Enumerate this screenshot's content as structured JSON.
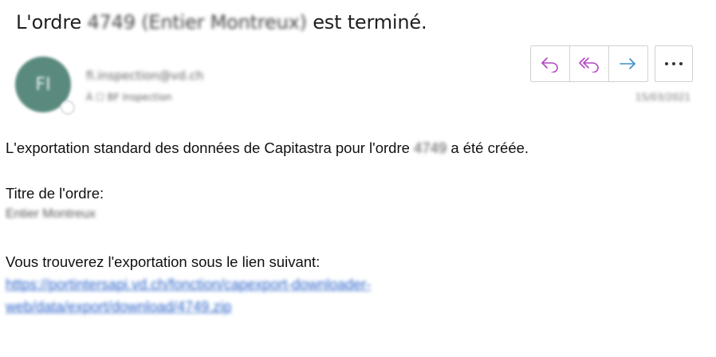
{
  "subject": {
    "prefix": "L'ordre",
    "redacted": "4749 (Entier Montreux)",
    "suffix": "est terminé."
  },
  "sender": {
    "initials": "FI",
    "email": "fi.inspection@vd.ch",
    "recipient": "À  ☐ BF Inspection",
    "date": "15/03/2021"
  },
  "actions": {
    "reply_icon": "reply-icon",
    "reply_all_icon": "reply-all-icon",
    "forward_icon": "forward-icon",
    "more_icon": "more-icon",
    "reply_color": "#b146c2",
    "forward_color": "#3a8fc8"
  },
  "body": {
    "line1_prefix": "L'exportation standard des données de Capitastra pour l'ordre",
    "line1_redacted": "4749",
    "line1_suffix": "a été créée.",
    "title_label": "Titre de l'ordre:",
    "title_value": "Entier Montreux",
    "link_intro": "Vous trouverez l'exportation sous le lien suivant:",
    "link_line1": "https://portintersapi.vd.ch/fonction/capexport-downloader-",
    "link_line2": "web/data/export/download/4749.zip"
  }
}
